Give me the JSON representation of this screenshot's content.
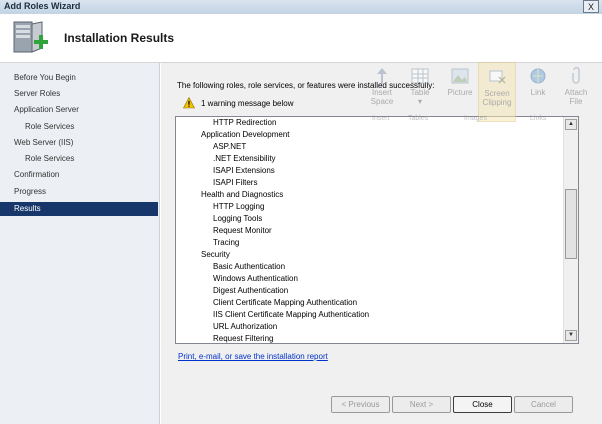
{
  "window": {
    "title": "Add Roles Wizard",
    "close_glyph": "X"
  },
  "header": {
    "title": "Installation Results",
    "icon": "server-roles-add-icon"
  },
  "nav": {
    "items": [
      {
        "label": "Before You Begin",
        "sub": false,
        "active": false
      },
      {
        "label": "Server Roles",
        "sub": false,
        "active": false
      },
      {
        "label": "Application Server",
        "sub": false,
        "active": false
      },
      {
        "label": "Role Services",
        "sub": true,
        "active": false
      },
      {
        "label": "Web Server (IIS)",
        "sub": false,
        "active": false
      },
      {
        "label": "Role Services",
        "sub": true,
        "active": false
      },
      {
        "label": "Confirmation",
        "sub": false,
        "active": false
      },
      {
        "label": "Progress",
        "sub": false,
        "active": false
      },
      {
        "label": "Results",
        "sub": false,
        "active": true
      }
    ]
  },
  "main": {
    "intro": "The following roles, role services, or features were installed successfully:",
    "warning": "1 warning message below",
    "list": [
      {
        "text": "HTTP Redirection",
        "level": 2
      },
      {
        "text": "Application Development",
        "level": 1
      },
      {
        "text": "ASP.NET",
        "level": 2
      },
      {
        "text": ".NET Extensibility",
        "level": 2
      },
      {
        "text": "ISAPI Extensions",
        "level": 2
      },
      {
        "text": "ISAPI Filters",
        "level": 2
      },
      {
        "text": "Health and Diagnostics",
        "level": 1
      },
      {
        "text": "HTTP Logging",
        "level": 2
      },
      {
        "text": "Logging Tools",
        "level": 2
      },
      {
        "text": "Request Monitor",
        "level": 2
      },
      {
        "text": "Tracing",
        "level": 2
      },
      {
        "text": "Security",
        "level": 1
      },
      {
        "text": "Basic Authentication",
        "level": 2
      },
      {
        "text": "Windows Authentication",
        "level": 2
      },
      {
        "text": "Digest Authentication",
        "level": 2
      },
      {
        "text": "Client Certificate Mapping Authentication",
        "level": 2
      },
      {
        "text": "IIS Client Certificate Mapping Authentication",
        "level": 2
      },
      {
        "text": "URL Authorization",
        "level": 2
      },
      {
        "text": "Request Filtering",
        "level": 2
      }
    ],
    "report_link": "Print, e-mail, or save the installation report"
  },
  "buttons": {
    "previous": "< Previous",
    "next": "Next >",
    "close": "Close",
    "cancel": "Cancel"
  },
  "ribbon": {
    "groups": [
      {
        "label1": "Insert",
        "label2": "Space",
        "icon": "insert-space-icon"
      },
      {
        "label1": "Table",
        "label2": "",
        "icon": "table-icon"
      },
      {
        "label1": "Picture",
        "label2": "",
        "icon": "picture-icon"
      },
      {
        "label1": "Screen",
        "label2": "Clipping",
        "icon": "screen-clipping-icon"
      },
      {
        "label1": "Link",
        "label2": "",
        "icon": "link-icon"
      },
      {
        "label1": "Attach",
        "label2": "File",
        "icon": "attach-file-icon"
      }
    ],
    "captions": [
      "Insert",
      "Tables",
      "Images",
      "Links"
    ]
  }
}
